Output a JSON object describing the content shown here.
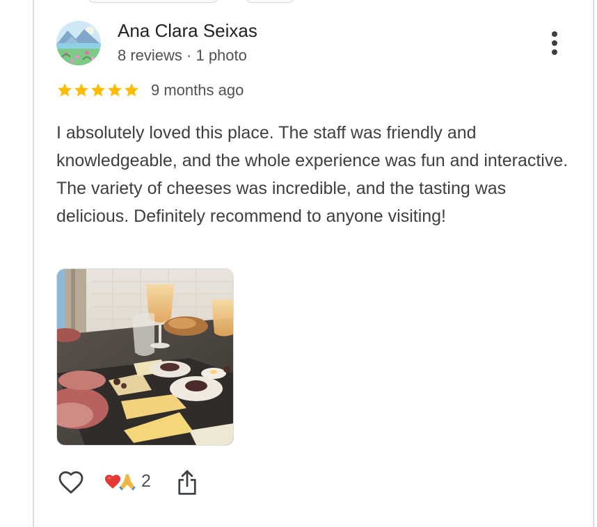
{
  "review": {
    "reviewer_name": "Ana Clara Seixas",
    "reviewer_meta": "8 reviews · 1 photo",
    "rating": 5,
    "rating_max": 5,
    "date": "9 months ago",
    "text": "I absolutely loved this place. The staff was friendly and knowledgeable, and the whole experience was fun and interactive. The variety of cheeses was incredible, and the tasting was delicious. Definitely recommend to anyone visiting!",
    "reaction_count": "2"
  },
  "icons": {
    "avatar": "avatar-landscape-icon",
    "more": "more-vertical-icon",
    "star": "star-icon",
    "like": "heart-outline-icon",
    "reaction_heart": "red-heart-emoji",
    "reaction_pray": "folded-hands-emoji",
    "share": "share-icon"
  },
  "colors": {
    "star": "#fbbc04",
    "text_primary": "#202124",
    "text_secondary": "#4d5156",
    "icon": "#3c4043",
    "divider": "#dadce0"
  }
}
